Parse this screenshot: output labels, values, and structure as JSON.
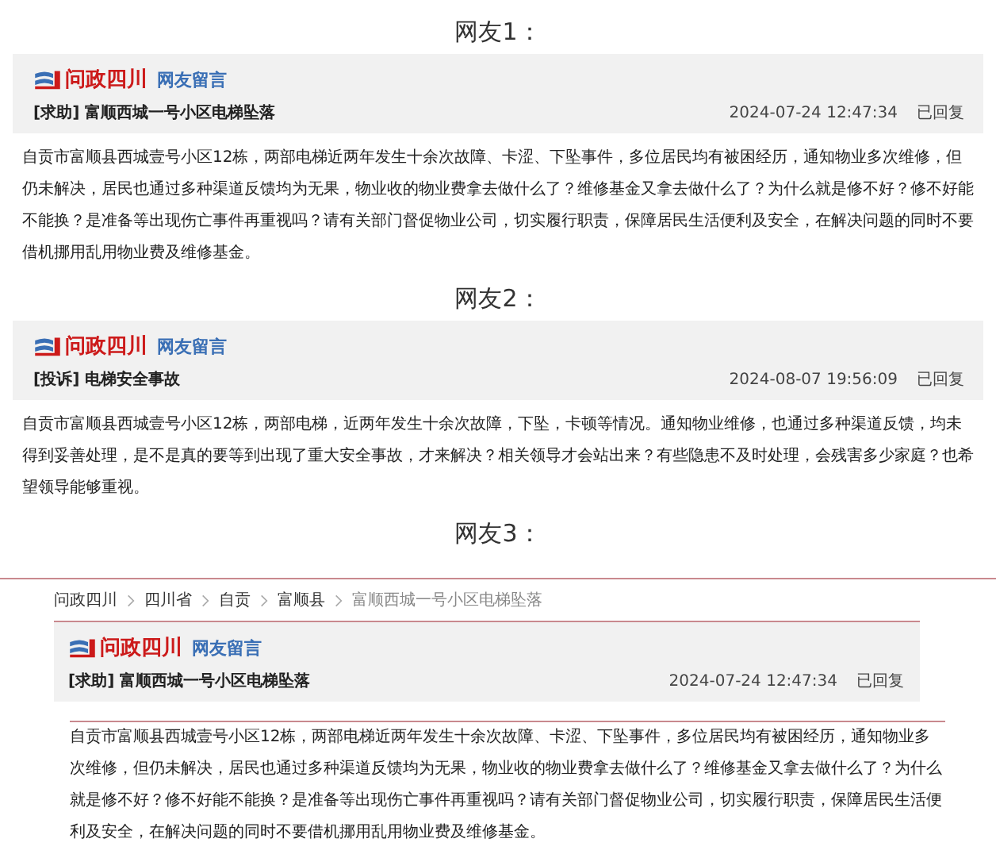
{
  "sections": [
    {
      "kind": "clip",
      "heading": "网友1：",
      "card": {
        "brand": "问政四川",
        "channel": "网友留言",
        "tag": "[求助]",
        "title": "富顺西城一号小区电梯坠落",
        "time": "2024-07-24 12:47:34",
        "status": "已回复"
      },
      "body": "自贡市富顺县西城壹号小区12栋，两部电梯近两年发生十余次故障、卡涩、下坠事件，多位居民均有被困经历，通知物业多次维修，但仍未解决，居民也通过多种渠道反馈均为无果，物业收的物业费拿去做什么了？维修基金又拿去做什么了？为什么就是修不好？修不好能不能换？是准备等出现伤亡事件再重视吗？请有关部门督促物业公司，切实履行职责，保障居民生活便利及安全，在解决问题的同时不要借机挪用乱用物业费及维修基金。"
    },
    {
      "kind": "clip",
      "heading": "网友2：",
      "card": {
        "brand": "问政四川",
        "channel": "网友留言",
        "tag": "[投诉]",
        "title": "电梯安全事故",
        "time": "2024-08-07 19:56:09",
        "status": "已回复"
      },
      "body": "自贡市富顺县西城壹号小区12栋，两部电梯，近两年发生十余次故障，下坠，卡顿等情况。通知物业维修，也通过多种渠道反馈，均未得到妥善处理，是不是真的要等到出现了重大安全事故，才来解决？相关领导才会站出来？有些隐患不及时处理，会残害多少家庭？也希望领导能够重视。"
    },
    {
      "kind": "page",
      "heading": "网友3：",
      "breadcrumb": [
        {
          "label": "问政四川",
          "current": false
        },
        {
          "label": "四川省",
          "current": false
        },
        {
          "label": "自贡",
          "current": false
        },
        {
          "label": "富顺县",
          "current": false
        },
        {
          "label": "富顺西城一号小区电梯坠落",
          "current": true
        }
      ],
      "card": {
        "brand": "问政四川",
        "channel": "网友留言",
        "tag": "[求助]",
        "title": "富顺西城一号小区电梯坠落",
        "time": "2024-07-24 12:47:34",
        "status": "已回复"
      },
      "body": "自贡市富顺县西城壹号小区12栋，两部电梯近两年发生十余次故障、卡涩、下坠事件，多位居民均有被困经历，通知物业多次维修，但仍未解决，居民也通过多种渠道反馈均为无果，物业收的物业费拿去做什么了？维修基金又拿去做什么了？为什么就是修不好？修不好能不能换？是准备等出现伤亡事件再重视吗？请有关部门督促物业公司，切实履行职责，保障居民生活便利及安全，在解决问题的同时不要借机挪用乱用物业费及维修基金。"
    }
  ]
}
